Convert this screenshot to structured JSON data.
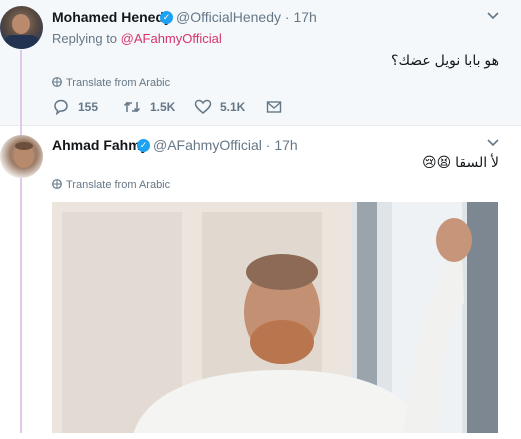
{
  "tweets": [
    {
      "name": "Mohamed Henedy",
      "handle": "@OfficialHenedy",
      "time": "17h",
      "reply_prefix": "Replying to ",
      "reply_to": "@AFahmyOfficial",
      "text": "هو بابا نويل عضك؟",
      "translate": "Translate from Arabic",
      "actions": {
        "replies": "155",
        "retweets": "1.5K",
        "likes": "5.1K"
      }
    },
    {
      "name": "Ahmad Fahmy",
      "handle": "@AFahmyOfficial",
      "time": "17h",
      "text": "لأ السقا 😫😢",
      "translate": "Translate from Arabic"
    }
  ],
  "sep": "·",
  "colors": {
    "link": "#d6336c",
    "verified": "#1da1f2",
    "muted": "#657786"
  }
}
